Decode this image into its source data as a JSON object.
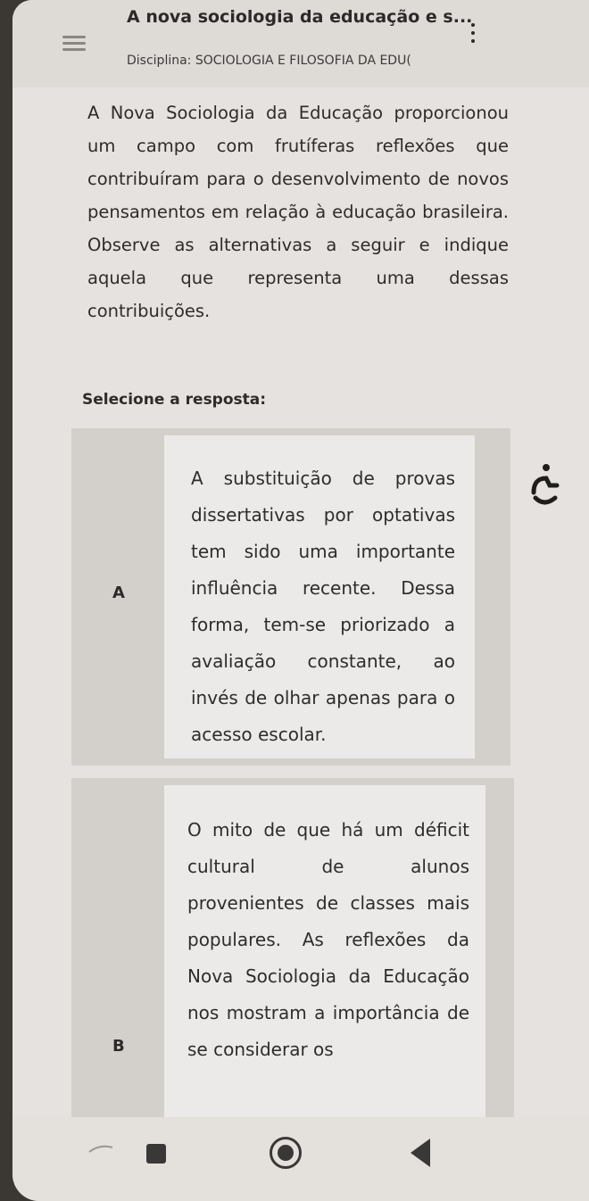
{
  "header": {
    "title": "A nova sociologia da educação e s...",
    "subtitle": "Disciplina: SOCIOLOGIA E FILOSOFIA DA EDU(",
    "menu_icon": "hamburger-menu-icon",
    "more_icon": "more-vert-icon"
  },
  "question": {
    "text": "A Nova Sociologia da Educação proporcionou um campo com frutíferas reflexões que contribuíram para o desenvolvimento de novos pensamentos em relação à educação brasileira. Observe as alternativas a seguir e indique aquela que representa uma dessas contribuições."
  },
  "answers": {
    "select_label": "Selecione a resposta:",
    "options": [
      {
        "letter": "A",
        "text": "A substituição de provas dissertativas por optativas tem sido uma importante influência recente. Dessa forma, tem-se priorizado a avaliação constante, ao invés de olhar apenas para o acesso escolar."
      },
      {
        "letter": "B",
        "text": "O mito de que há um déficit cultural de alunos provenientes de classes mais populares. As reflexões da Nova Sociologia da Educação nos mostram a importância de se considerar os"
      }
    ]
  },
  "colors": {
    "background": "#e6e2df",
    "option_bg": "#d3cfcb",
    "option_body": "#eceae8",
    "text": "#2e2c2a"
  }
}
